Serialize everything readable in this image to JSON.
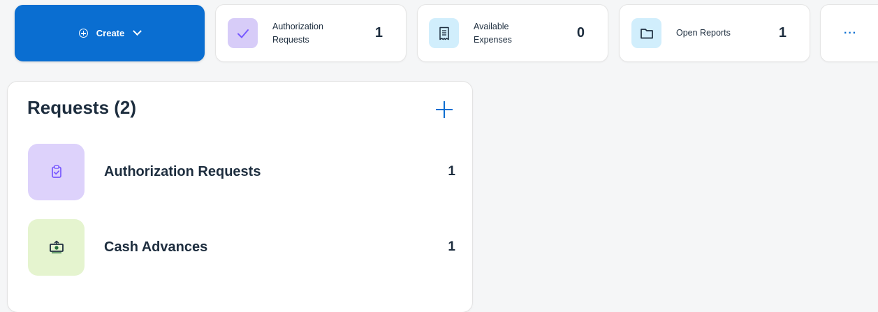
{
  "topbar": {
    "create": {
      "label": "Create",
      "icon": "plus-circle-icon",
      "caret": "chevron-down-icon"
    },
    "tiles": [
      {
        "label": "Authorization Requests",
        "count": "1",
        "icon": "checkmark-icon",
        "accent": "#7858ff"
      },
      {
        "label": "Available Expenses",
        "count": "0",
        "icon": "receipt-icon",
        "accent": "#0070f2"
      },
      {
        "label": "Open Reports",
        "count": "1",
        "icon": "folder-icon",
        "accent": "#0070f2"
      }
    ],
    "more": "···"
  },
  "requests": {
    "title": "Requests (2)",
    "add_icon": "plus-icon",
    "items": [
      {
        "label": "Authorization Requests",
        "count": "1",
        "icon": "clipboard-check-icon",
        "accent": "#7858ff"
      },
      {
        "label": "Cash Advances",
        "count": "1",
        "icon": "cash-icon",
        "accent": "#256f3a"
      }
    ]
  },
  "colors": {
    "primary": "#0a6ed1",
    "background": "#f5f6f7",
    "text": "#1d2d3e"
  }
}
